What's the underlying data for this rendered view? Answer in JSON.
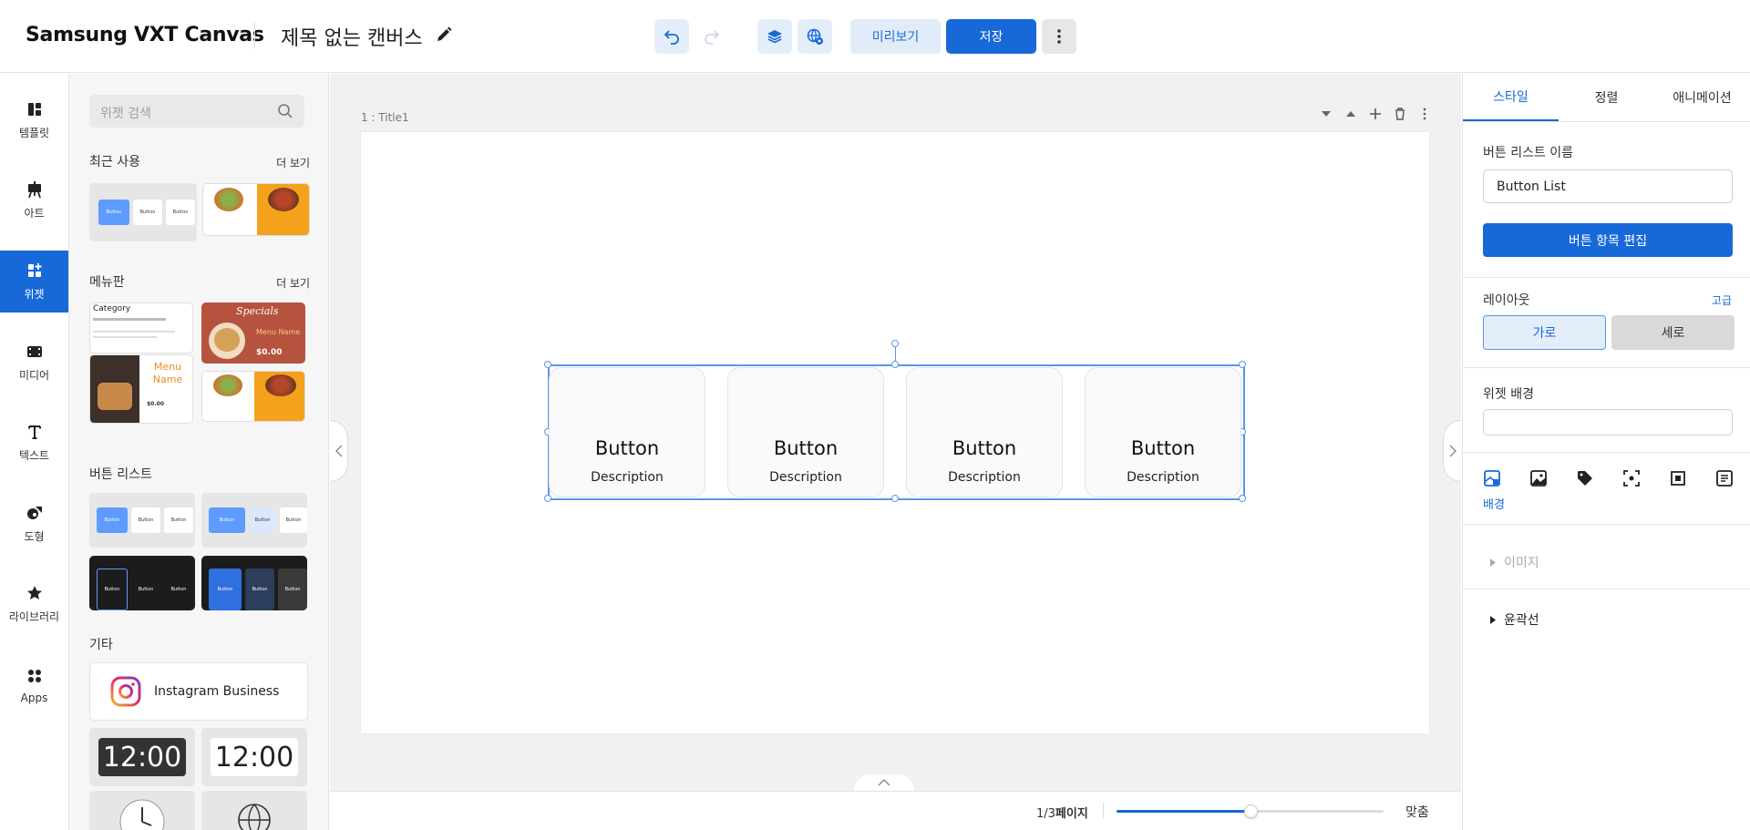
{
  "app": {
    "brand": "Samsung VXT Canvas",
    "doc_title": "제목 없는 캔버스"
  },
  "toolbar": {
    "preview_label": "미리보기",
    "save_label": "저장"
  },
  "nav": {
    "items": [
      {
        "label": "템플릿",
        "icon": "template-icon"
      },
      {
        "label": "아트",
        "icon": "easel-icon"
      },
      {
        "label": "위젯",
        "icon": "widget-icon"
      },
      {
        "label": "미디어",
        "icon": "film-icon"
      },
      {
        "label": "텍스트",
        "icon": "text-icon"
      },
      {
        "label": "도형",
        "icon": "shapes-icon"
      },
      {
        "label": "라이브러리",
        "icon": "star-icon"
      },
      {
        "label": "Apps",
        "icon": "apps-icon"
      }
    ]
  },
  "widgets": {
    "search_placeholder": "위젯 검색",
    "recent_title": "최근 사용",
    "recent_more": "더 보기",
    "menu_title": "메뉴판",
    "menu_more": "더 보기",
    "buttonlist_title": "버튼 리스트",
    "etc_title": "기타",
    "instagram_label": "Instagram Business",
    "clock_digital_dark": "12:00",
    "clock_digital_light": "12:00",
    "thumb_texts": {
      "button": "Button",
      "menu_category": "Category",
      "menu_specials": "Specials",
      "menu_name": "Menu Name",
      "menu_price": "$0.00"
    }
  },
  "canvas": {
    "page_label": "1 :  Title1",
    "buttons": [
      {
        "title": "Button",
        "description": "Description"
      },
      {
        "title": "Button",
        "description": "Description"
      },
      {
        "title": "Button",
        "description": "Description"
      },
      {
        "title": "Button",
        "description": "Description"
      }
    ]
  },
  "bottom": {
    "page_current": "1/3",
    "page_suffix": "페이지",
    "zoom_level": 0.5,
    "fit_label": "맞춤"
  },
  "props": {
    "tabs": [
      "스타일",
      "정렬",
      "애니메이션"
    ],
    "active_tab": "스타일",
    "name_label": "버튼 리스트 이름",
    "name_value": "Button List",
    "edit_items_label": "버튼 항목 편집",
    "layout_label": "레이아웃",
    "advanced_label": "고급",
    "layout_options": [
      "가로",
      "세로"
    ],
    "layout_selected": "가로",
    "bg_label": "위젯 배경",
    "bg_value": "",
    "style_icons": [
      "background-icon",
      "image-icon",
      "tag-icon",
      "focus-icon",
      "padding-icon",
      "list-icon"
    ],
    "style_caption": "배경",
    "image_section": "이미지",
    "outline_section": "윤곽선"
  },
  "colors": {
    "accent": "#1769d8",
    "accent_light": "#e1ecf8",
    "selection": "#5a96ea"
  }
}
